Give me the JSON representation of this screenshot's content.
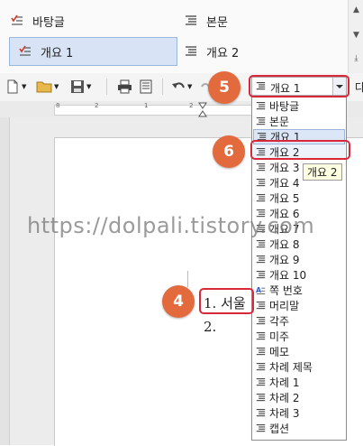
{
  "gallery": {
    "items": [
      {
        "label": "바탕글",
        "icon": "checklist-style-icon"
      },
      {
        "label": "본문",
        "icon": "paragraph-lines-icon"
      },
      {
        "label": "개요 1",
        "icon": "checklist-style-icon",
        "selected": true
      },
      {
        "label": "개요 2",
        "icon": "paragraph-lines-icon"
      }
    ]
  },
  "toolbar": {
    "style_combo_value": "개요 1",
    "partial_label": "다"
  },
  "ruler": {
    "numbers": [
      "8",
      "2",
      "1",
      "2"
    ]
  },
  "style_list": {
    "items": [
      "바탕글",
      "본문",
      "개요 1",
      "개요 2",
      "개요 3",
      "개요 4",
      "개요 5",
      "개요 6",
      "개요 7",
      "개요 8",
      "개요 9",
      "개요 10",
      "쪽 번호",
      "머리말",
      "각주",
      "미주",
      "메모",
      "차례 제목",
      "차례 1",
      "차례 2",
      "차례 3",
      "캡션"
    ],
    "highlighted_index": 2,
    "hover_index": 3
  },
  "tooltip": "개요 2",
  "document": {
    "lines": [
      "1. 서울",
      "2."
    ]
  },
  "annotations": {
    "step4": "4",
    "step5": "5",
    "step6": "6"
  },
  "watermark": "https://dolpali.tistory.com",
  "colors": {
    "badge": "#e26a3d",
    "highlight_box": "#d8283a",
    "selection": "#dbe6f7"
  }
}
